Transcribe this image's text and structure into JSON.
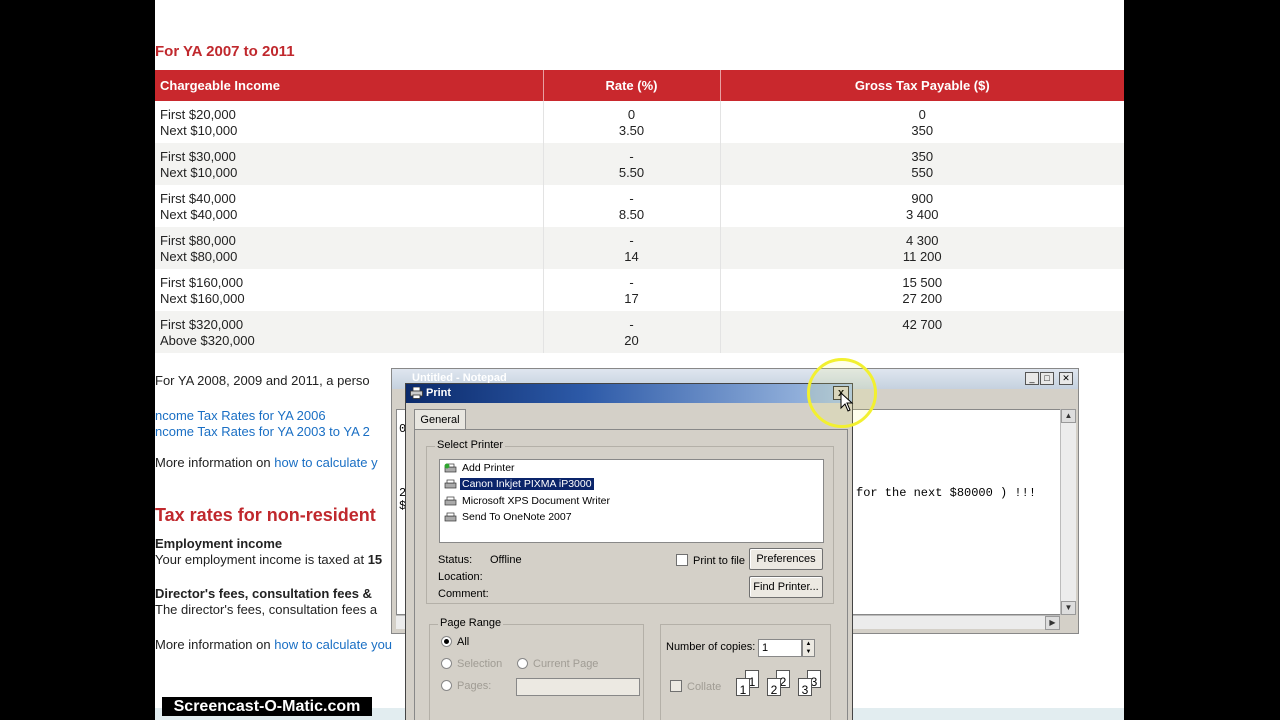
{
  "page": {
    "heading": "For YA 2007 to 2011",
    "table": {
      "headers": [
        "Chargeable Income",
        "Rate (%)",
        "Gross Tax Payable ($)"
      ],
      "rows": [
        {
          "income1": "First $20,000",
          "income2": "Next $10,000",
          "rate1": "0",
          "rate2": "3.50",
          "tax1": "0",
          "tax2": "350"
        },
        {
          "income1": "First $30,000",
          "income2": "Next $10,000",
          "rate1": "-",
          "rate2": "5.50",
          "tax1": "350",
          "tax2": "550"
        },
        {
          "income1": "First $40,000",
          "income2": "Next $40,000",
          "rate1": "-",
          "rate2": "8.50",
          "tax1": "900",
          "tax2": "3 400"
        },
        {
          "income1": "First $80,000",
          "income2": "Next $80,000",
          "rate1": "-",
          "rate2": "14",
          "tax1": "4 300",
          "tax2": "11 200"
        },
        {
          "income1": "First $160,000",
          "income2": "Next $160,000",
          "rate1": "-",
          "rate2": "17",
          "tax1": "15 500",
          "tax2": "27 200"
        },
        {
          "income1": "First $320,000",
          "income2": "Above $320,000",
          "rate1": "-",
          "rate2": "20",
          "tax1": "42 700",
          "tax2": ""
        }
      ]
    },
    "note_text": "For YA 2008,  2009 and 2011, a perso",
    "link_2006": "ncome Tax Rates for YA 2006",
    "link_2003": "ncome Tax Rates for YA 2003 to YA 2",
    "more_info_prefix": "More information on ",
    "more_info_link": "how to calculate y",
    "nonres_heading": "Tax rates for non-resident",
    "employment_heading": "Employment income",
    "employment_text": "Your employment income is taxed at ",
    "employment_bold": "15",
    "directors_heading": "Director's fees, consultation fees &",
    "directors_text": "The director's fees, consultation fees a",
    "more_info2_prefix": "More information on ",
    "more_info2_link": "how to calculate you"
  },
  "notepad": {
    "title": "Untitled - Notepad",
    "line_fragment": "for the next $80000 ) !!!",
    "left_chars": {
      "a": "0",
      "b": "2",
      "c": "$"
    }
  },
  "print_dialog": {
    "title": "Print",
    "close_label": "x",
    "tab": "General",
    "select_printer_label": "Select Printer",
    "printers": [
      {
        "label": "Add Printer",
        "icon": "add-printer-icon",
        "selected": false
      },
      {
        "label": "Canon Inkjet PIXMA iP3000",
        "icon": "printer-icon",
        "selected": true
      },
      {
        "label": "Microsoft XPS Document Writer",
        "icon": "printer-icon",
        "selected": false
      },
      {
        "label": "Send To OneNote 2007",
        "icon": "printer-icon",
        "selected": false
      }
    ],
    "status_label": "Status:",
    "status_value": "Offline",
    "location_label": "Location:",
    "comment_label": "Comment:",
    "print_to_file": "Print to file",
    "preferences": "Preferences",
    "find_printer": "Find Printer...",
    "page_range_label": "Page Range",
    "all_label": "All",
    "selection_label": "Selection",
    "current_page_label": "Current Page",
    "pages_label": "Pages:",
    "copies_label": "Number of copies:",
    "copies_value": "1",
    "collate_label": "Collate",
    "collate_pages": [
      "1",
      "1",
      "2",
      "2",
      "3",
      "3"
    ]
  },
  "watermark": "Screencast-O-Matic.com",
  "colors": {
    "accent_red": "#c9282d",
    "link_blue": "#1a6fc4",
    "dialog_bg": "#d4d0c8",
    "selection_blue": "#0a246a",
    "cursor_ring": "#f2f030"
  }
}
